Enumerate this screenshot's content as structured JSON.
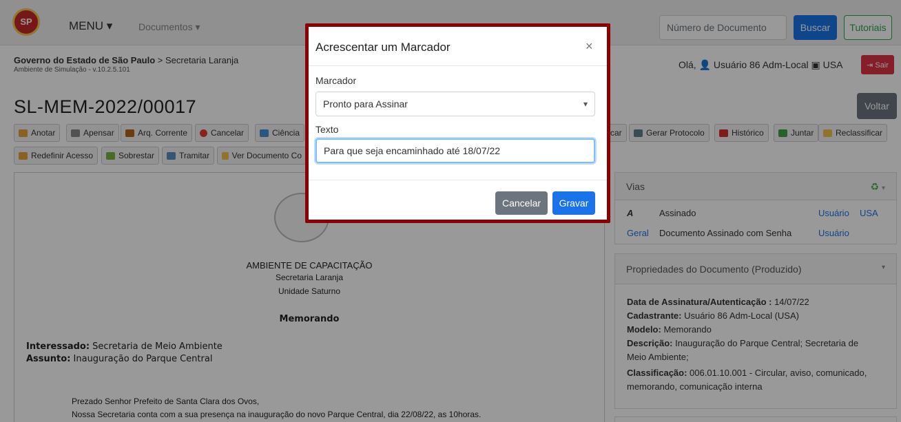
{
  "navbar": {
    "menu_label": "MENU ▾",
    "documents_label": "Documentos ▾",
    "search_placeholder": "Número de Documento",
    "search_button": "Buscar",
    "tutorials_button": "Tutoriais"
  },
  "subheader": {
    "org": "Governo do Estado de São Paulo",
    "org_sep": " > ",
    "dept": "Secretaria Laranja",
    "env": "Ambiente de Simulação - v.10.2.5.101",
    "greeting": "Olá, 👤 Usuário 86 Adm-Local ▣ USA",
    "logout": "⇥ Sair"
  },
  "document": {
    "code": "SL-MEM-2022/00017",
    "back_button": "Voltar"
  },
  "toolbar": {
    "row1": [
      "Anotar",
      "Apensar",
      "Arq. Corrente",
      "Cancelar",
      "Ciência"
    ],
    "row1_right": [
      "car",
      "Gerar Protocolo",
      "Histórico",
      "Juntar",
      "Reclassificar"
    ],
    "row2": [
      "Redefinir Acesso",
      "Sobrestar",
      "Tramitar",
      "Ver Documento Co"
    ]
  },
  "doc_body": {
    "heading": "AMBIENTE DE CAPACITAÇÃO",
    "sub1": "Secretaria Laranja",
    "sub2": "Unidade Saturno",
    "type": "Memorando",
    "interested_label": "Interessado:",
    "interested_value": " Secretaria de Meio Ambiente",
    "subject_label": "Assunto:",
    "subject_value": " Inauguração do Parque Central",
    "para1": "Prezado Senhor Prefeito de Santa Clara dos Ovos,",
    "para2": "Nossa Secretaria conta com a sua presença na inauguração do novo Parque Central, dia 22/08/22, as 10horas."
  },
  "vias": {
    "title": "Vias",
    "row1": {
      "label": "A",
      "desc": "Assinado",
      "user": "Usuário",
      "org": "USA"
    },
    "row2": {
      "label": "Geral",
      "desc": "Documento Assinado com Senha",
      "user": "Usuário"
    }
  },
  "properties": {
    "title": "Propriedades do Documento (Produzido)",
    "sign_date_label": "Data de Assinatura/Autenticação :",
    "sign_date_value": " 14/07/22",
    "registrant_label": "Cadastrante:",
    "registrant_value": " Usuário 86 Adm-Local (USA)",
    "model_label": "Modelo:",
    "model_value": " Memorando",
    "description_label": "Descrição:",
    "description_value": " Inauguração do Parque Central; Secretaria de",
    "description_value2": "Meio Ambiente;",
    "classification_label": "Classificação:",
    "classification_value": " 006.01.10.001 - Circular, aviso, comunicado,",
    "classification_value2": "memorando, comunicação interna"
  },
  "modal": {
    "title": "Acrescentar um Marcador",
    "close": "×",
    "marker_label": "Marcador",
    "marker_value": "Pronto para Assinar",
    "text_label": "Texto",
    "text_value": "Para que seja encaminhado até 18/07/22",
    "cancel_button": "Cancelar",
    "save_button": "Gravar"
  },
  "colors": {
    "modal_border": "#8b0000",
    "primary": "#1a73e8",
    "danger": "#dc3545",
    "secondary": "#6c757d",
    "success": "#28a745"
  }
}
